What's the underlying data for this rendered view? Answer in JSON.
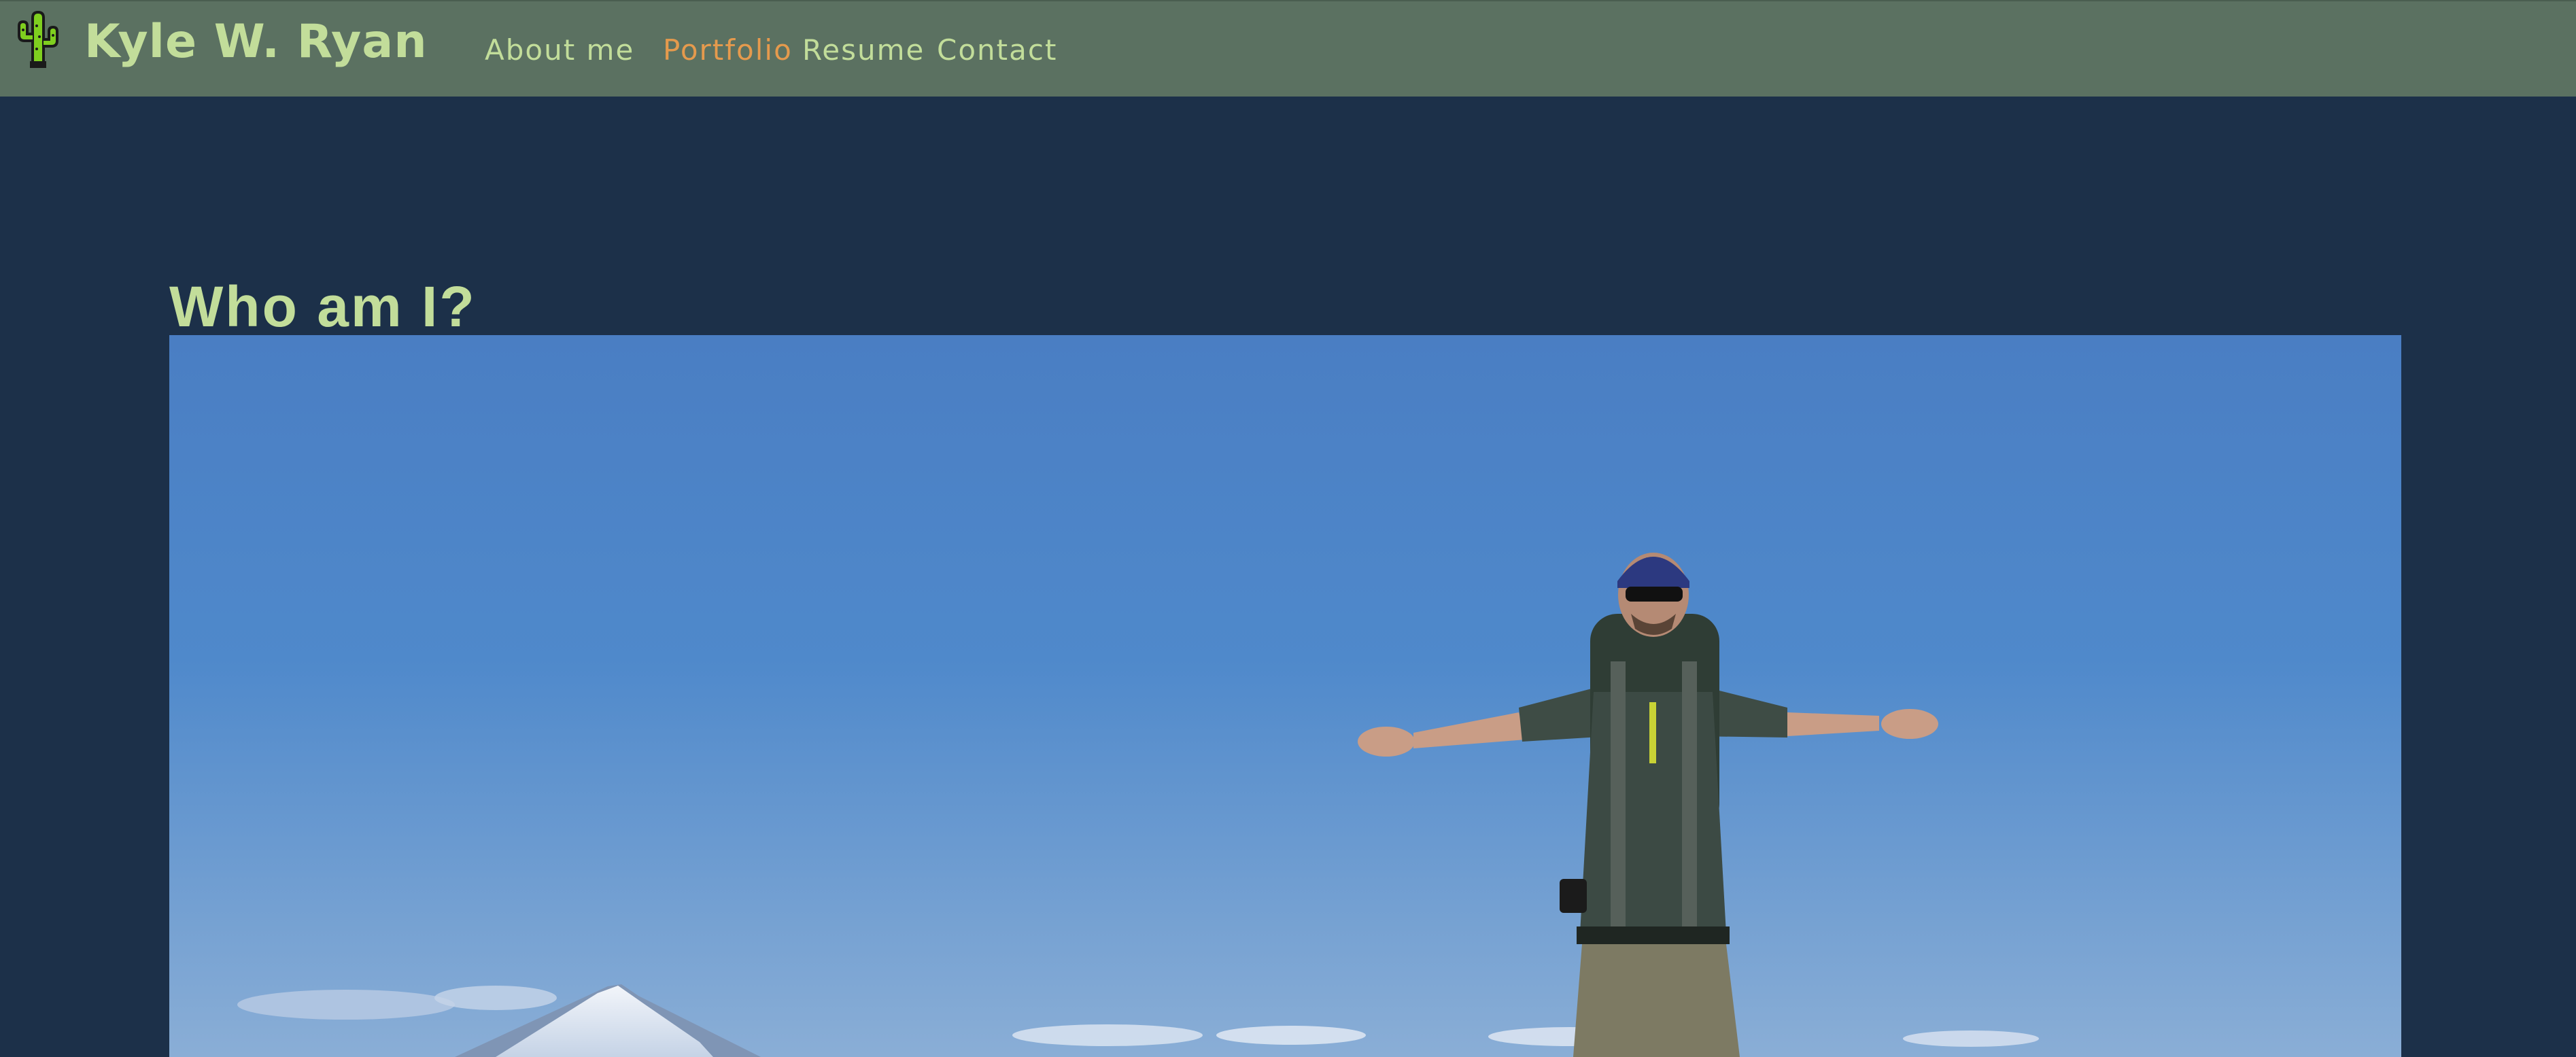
{
  "header": {
    "brand_name": "Kyle W. Ryan",
    "logo_icon": "cactus-icon",
    "nav": [
      {
        "label": "About me",
        "active": false
      },
      {
        "label": "Portfolio",
        "active": true
      },
      {
        "label": "Resume",
        "active": false
      },
      {
        "label": "Contact",
        "active": false
      }
    ]
  },
  "main": {
    "heading": "Who am I?",
    "photo_subject": "hiker-with-outstretched-arms-photo"
  },
  "colors": {
    "navbar_bg": "#5b7161",
    "page_bg": "#1c3049",
    "text_green": "#c2dd9a",
    "active_orange": "#e59a4d"
  }
}
